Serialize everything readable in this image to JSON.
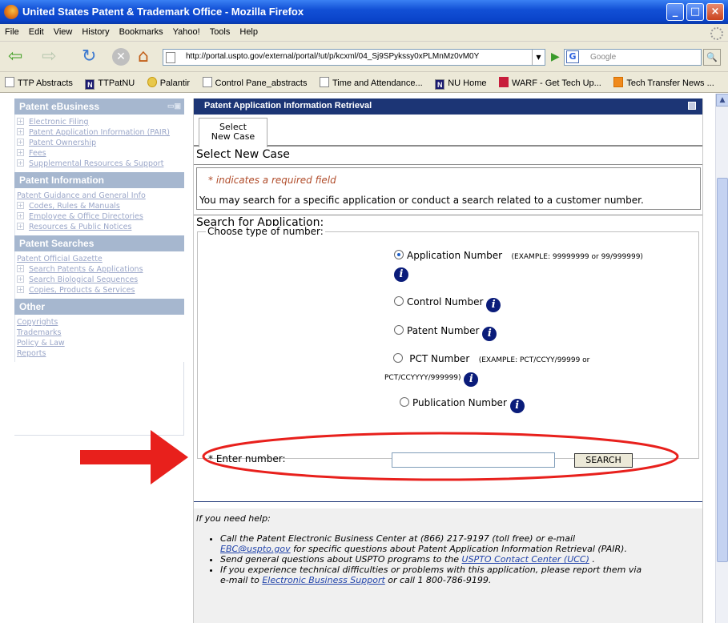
{
  "window": {
    "title": "United States Patent & Trademark Office - Mozilla Firefox",
    "min_label": "_",
    "max_label": "□",
    "close_label": "×"
  },
  "menu": [
    "File",
    "Edit",
    "View",
    "History",
    "Bookmarks",
    "Yahoo!",
    "Tools",
    "Help"
  ],
  "nav": {
    "back": "⇦",
    "forward": "⇨",
    "reload": "↻",
    "stop": "✕",
    "home": "⌂",
    "url": "http://portal.uspto.gov/external/portal/!ut/p/kcxml/04_Sj9SPykssy0xPLMnMz0vM0Y",
    "go": "▶",
    "search_placeholder": "Google",
    "search_icon": "G",
    "search_go": "🔍"
  },
  "bookmarks": [
    {
      "label": "TTP Abstracts",
      "icon": "page"
    },
    {
      "label": "TTPatNU",
      "icon": "n"
    },
    {
      "label": "Palantir",
      "icon": "p"
    },
    {
      "label": "Control Pane_abstracts",
      "icon": "page"
    },
    {
      "label": "Time and Attendance...",
      "icon": "page"
    },
    {
      "label": "NU Home",
      "icon": "n"
    },
    {
      "label": "WARF - Get Tech Up...",
      "icon": "w"
    },
    {
      "label": "Tech Transfer News ...",
      "icon": "r"
    }
  ],
  "sidebar": {
    "sections": [
      {
        "title": "Patent eBusiness",
        "items": [
          "Electronic Filing",
          "Patent Application Information (PAIR)",
          "Patent Ownership",
          "Fees",
          "Supplemental Resources & Support"
        ],
        "plain_items": []
      },
      {
        "title": "Patent Information",
        "plain_items": [
          "Patent Guidance and General Info"
        ],
        "items": [
          "Codes, Rules & Manuals",
          "Employee & Office Directories",
          "Resources & Public Notices"
        ]
      },
      {
        "title": "Patent Searches",
        "plain_items": [
          "Patent Official Gazette"
        ],
        "items": [
          "Search Patents & Applications",
          "Search Biological Sequences",
          "Copies, Products & Services"
        ]
      },
      {
        "title": "Other",
        "plain_items": [
          "Copyrights",
          "Trademarks",
          "Policy & Law",
          "Reports"
        ],
        "items": []
      }
    ]
  },
  "main": {
    "panel_title": "Patent Application Information Retrieval",
    "tab_label_line1": "Select",
    "tab_label_line2": "New Case",
    "section_title": "Select New Case",
    "required_note": "* indicates a required field",
    "search_note": "You may search for a specific application or conduct a search related to a customer number.",
    "search_heading": "Search for Application:",
    "legend": "Choose type of number:",
    "radios": {
      "application": {
        "label": "Application Number",
        "example": "(EXAMPLE: 99999999 or 99/999999)",
        "selected": true
      },
      "control": {
        "label": "Control Number"
      },
      "patent": {
        "label": "Patent Number"
      },
      "pct": {
        "label": "PCT Number",
        "example_line1": "(EXAMPLE: PCT/CCYY/99999 or",
        "example_line2": "PCT/CCYYYY/999999)"
      },
      "publication": {
        "label": "Publication Number"
      }
    },
    "info_glyph": "i",
    "enter_label": "* Enter number:",
    "number_value": "",
    "search_button": "SEARCH"
  },
  "help": {
    "intro": "If you need help:",
    "line1a": "Call the Patent Electronic Business Center at (866) 217-9197 (toll free) or e-mail",
    "line1_link": "EBC@uspto.gov",
    "line1b": " for specific questions about Patent Application Information Retrieval (PAIR).",
    "line2a": "Send general questions about USPTO programs to the ",
    "line2_link": "USPTO Contact Center (UCC)",
    "line2b": " .",
    "line3a": "If you experience technical difficulties or problems with this application, please report them via",
    "line3b": "e-mail to ",
    "line3_link": "Electronic Business Support",
    "line3c": " or call 1 800-786-9199."
  },
  "colors": {
    "panel_header": "#1c3575",
    "sidebar_header": "#a6b7cf",
    "annotation_red": "#e8201c"
  }
}
